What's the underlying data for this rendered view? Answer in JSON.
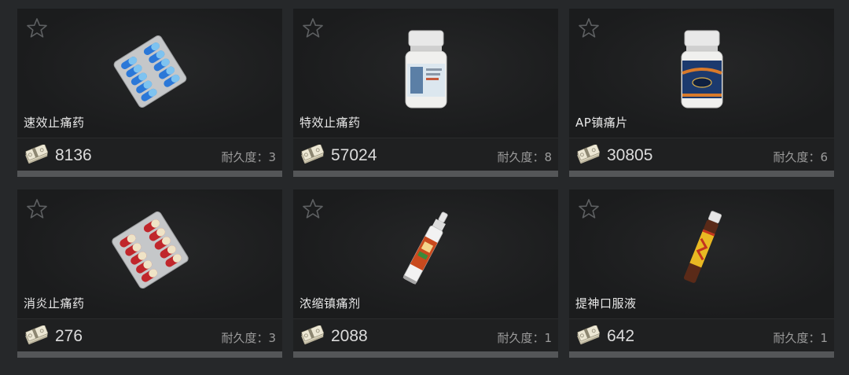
{
  "items": [
    {
      "name": "速效止痛药",
      "price": "8136",
      "durability": "耐久度：3",
      "icon": "blue-pill-blister-icon"
    },
    {
      "name": "特效止痛药",
      "price": "57024",
      "durability": "耐久度：8",
      "icon": "white-pill-bottle-icon"
    },
    {
      "name": "AP镇痛片",
      "price": "30805",
      "durability": "耐久度：6",
      "icon": "blue-label-pill-bottle-icon"
    },
    {
      "name": "消炎止痛药",
      "price": "276",
      "durability": "耐久度：3",
      "icon": "red-pill-blister-icon"
    },
    {
      "name": "浓缩镇痛剂",
      "price": "2088",
      "durability": "耐久度：1",
      "icon": "ointment-tube-icon"
    },
    {
      "name": "提神口服液",
      "price": "642",
      "durability": "耐久度：1",
      "icon": "oral-liquid-vial-icon"
    }
  ],
  "colors": {
    "card_bg": "#1b1c1d",
    "page_bg": "#26282a",
    "price_text": "#dcdcdc",
    "durability_text": "#9c9c9c",
    "strip": "#545658"
  },
  "icons": {
    "favorite": "star-outline-icon",
    "currency": "money-stack-icon"
  }
}
